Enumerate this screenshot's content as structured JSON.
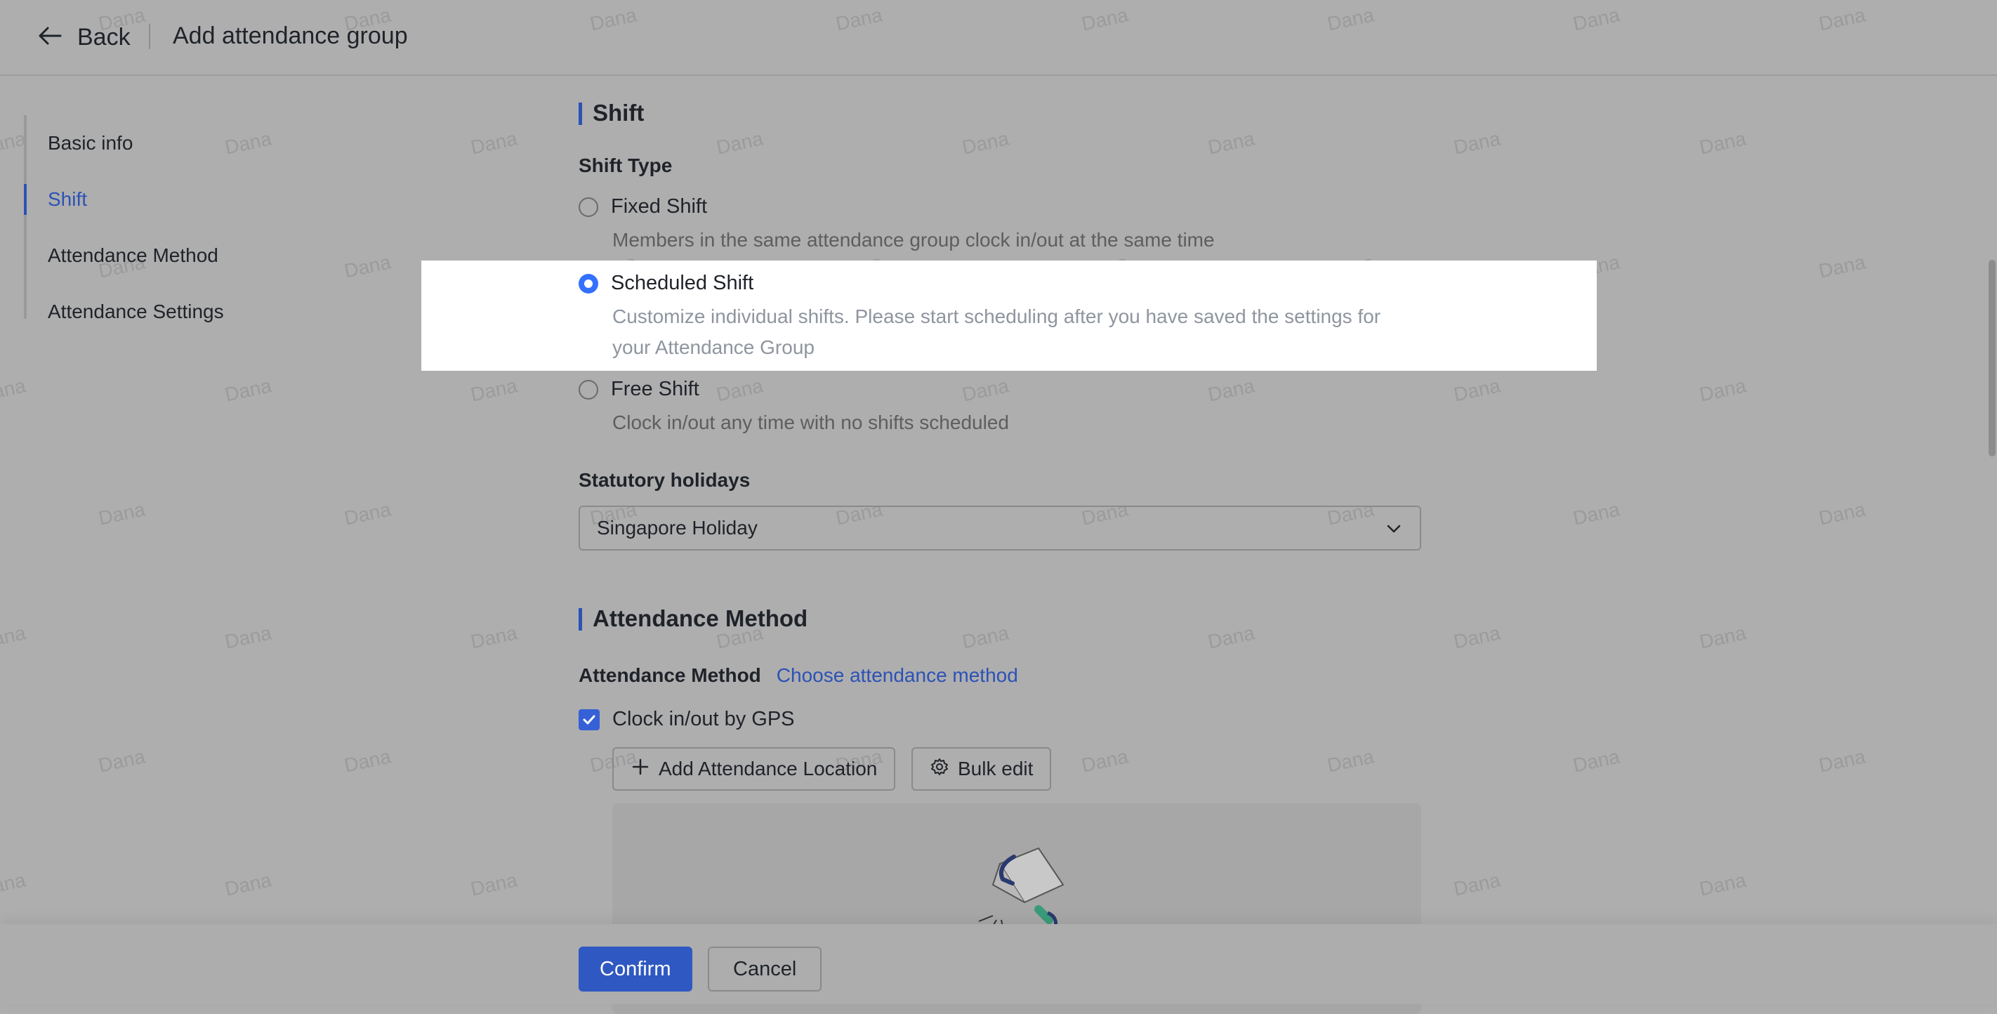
{
  "header": {
    "back_label": "Back",
    "title": "Add attendance group"
  },
  "sidebar": {
    "items": [
      {
        "label": "Basic info",
        "active": false
      },
      {
        "label": "Shift",
        "active": true
      },
      {
        "label": "Attendance Method",
        "active": false
      },
      {
        "label": "Attendance Settings",
        "active": false
      }
    ]
  },
  "shift": {
    "section_title": "Shift",
    "shift_type_label": "Shift Type",
    "options": [
      {
        "label": "Fixed Shift",
        "description": "Members in the same attendance group clock in/out at the same time",
        "selected": false
      },
      {
        "label": "Scheduled Shift",
        "description": "Customize individual shifts. Please start scheduling after you have saved the settings for your Attendance Group",
        "selected": true
      },
      {
        "label": "Free Shift",
        "description": "Clock in/out any time with no shifts scheduled",
        "selected": false
      }
    ],
    "holidays_label": "Statutory holidays",
    "holidays_value": "Singapore Holiday"
  },
  "attendance_method": {
    "section_title": "Attendance Method",
    "label": "Attendance Method",
    "choose_link": "Choose attendance method",
    "gps_label": "Clock in/out by GPS",
    "gps_checked": true,
    "add_location_label": "Add Attendance Location",
    "bulk_edit_label": "Bulk edit"
  },
  "footer": {
    "confirm_label": "Confirm",
    "cancel_label": "Cancel"
  },
  "watermark": "Dana",
  "colors": {
    "accent": "#2c52b6",
    "primary_button": "#2f58c2",
    "radio_checked": "#3370ff",
    "overlay_bg": "#aeaeae"
  }
}
